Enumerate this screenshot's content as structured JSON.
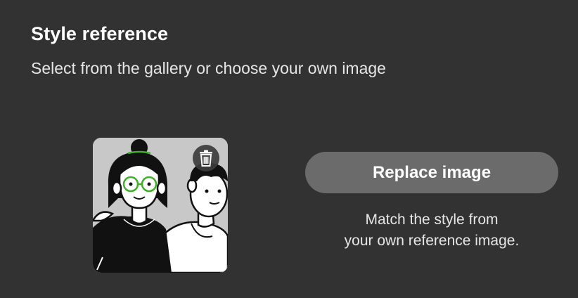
{
  "header": {
    "title": "Style reference",
    "subtitle": "Select from the gallery or choose your own image"
  },
  "reference_image": {
    "description_icon": "illustration-thumbnail",
    "delete_icon": "trash-icon"
  },
  "actions": {
    "replace_label": "Replace image"
  },
  "hint": {
    "line1": "Match the style from",
    "line2": "your own reference image."
  },
  "colors": {
    "background": "#323232",
    "button": "#6b6b6b",
    "accent_glasses": "#3fae2a"
  }
}
